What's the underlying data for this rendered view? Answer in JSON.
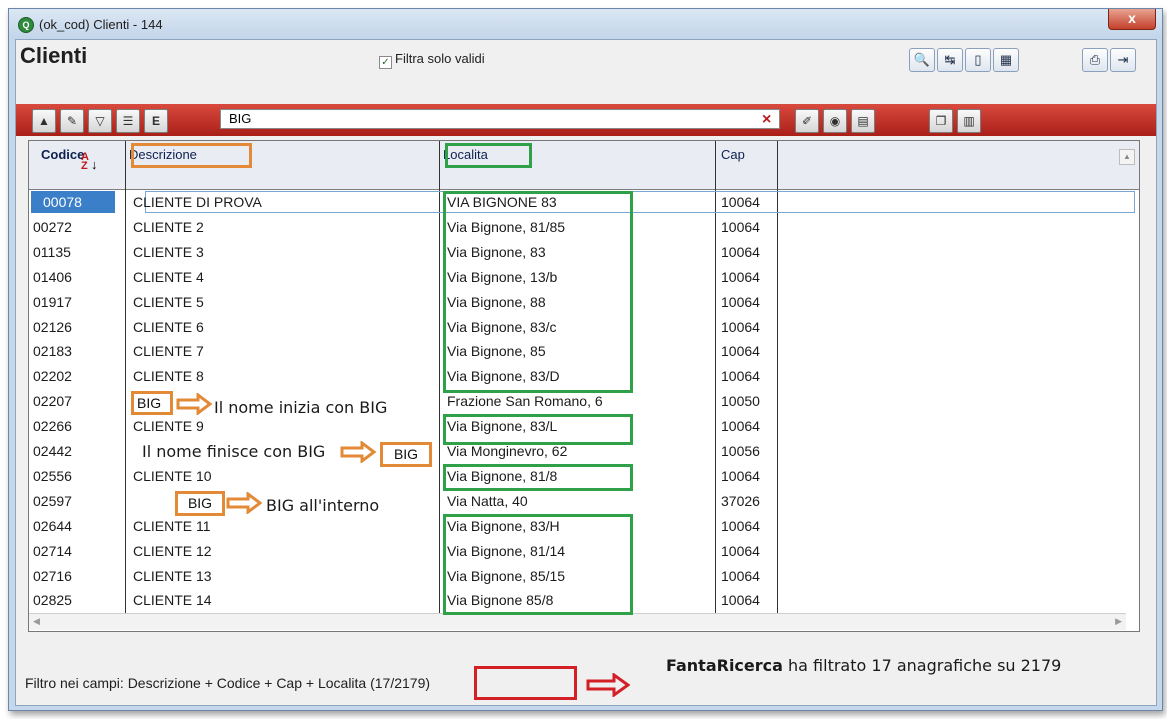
{
  "window": {
    "app_icon": "Q",
    "title": "(ok_cod) Clienti - 144",
    "close": "x"
  },
  "header": {
    "title": "Clienti",
    "filter_label": "Filtra solo validi",
    "filter_checked": true,
    "toolbar_icons": [
      "search-icon",
      "refresh-icon",
      "new-document-icon",
      "form-view-icon",
      "print-icon",
      "exit-icon"
    ]
  },
  "search": {
    "value": "BIG",
    "clear_label": "×",
    "left_icons": [
      "up-arrow-icon",
      "edit-filter-icon",
      "funnel-icon",
      "list-icon",
      "export-icon"
    ],
    "right_icons": [
      "wand-icon",
      "settings-icon",
      "note-icon",
      "window-icon",
      "doc-icon"
    ]
  },
  "columns": {
    "codice": "Codice",
    "descrizione": "Descrizione",
    "localita": "Localita",
    "cap": "Cap"
  },
  "rows": [
    {
      "codice": "00078",
      "descrizione": "CLIENTE DI PROVA",
      "localita": "VIA BIGNONE 83",
      "cap": "10064"
    },
    {
      "codice": "00272",
      "descrizione": "CLIENTE 2",
      "localita": "Via Bignone, 81/85",
      "cap": "10064"
    },
    {
      "codice": "01135",
      "descrizione": "CLIENTE 3",
      "localita": "Via Bignone, 83",
      "cap": "10064"
    },
    {
      "codice": "01406",
      "descrizione": "CLIENTE 4",
      "localita": "Via Bignone, 13/b",
      "cap": "10064"
    },
    {
      "codice": "01917",
      "descrizione": "CLIENTE 5",
      "localita": "Via Bignone, 88",
      "cap": "10064"
    },
    {
      "codice": "02126",
      "descrizione": "CLIENTE 6",
      "localita": "Via Bignone, 83/c",
      "cap": "10064"
    },
    {
      "codice": "02183",
      "descrizione": "CLIENTE 7",
      "localita": "Via Bignone, 85",
      "cap": "10064"
    },
    {
      "codice": "02202",
      "descrizione": "CLIENTE 8",
      "localita": "Via Bignone, 83/D",
      "cap": "10064"
    },
    {
      "codice": "02207",
      "descrizione": "BIG",
      "localita": "Frazione San Romano, 6",
      "cap": "10050"
    },
    {
      "codice": "02266",
      "descrizione": "CLIENTE 9",
      "localita": "Via Bignone, 83/L",
      "cap": "10064"
    },
    {
      "codice": "02442",
      "descrizione": "BIG",
      "localita": "Via Monginevro, 62",
      "cap": "10056"
    },
    {
      "codice": "02556",
      "descrizione": "CLIENTE 10",
      "localita": "Via Bignone, 81/8",
      "cap": "10064"
    },
    {
      "codice": "02597",
      "descrizione": "BIG",
      "localita": "Via Natta, 40",
      "cap": "37026"
    },
    {
      "codice": "02644",
      "descrizione": "CLIENTE 11",
      "localita": "Via Bignone, 83/H",
      "cap": "10064"
    },
    {
      "codice": "02714",
      "descrizione": "CLIENTE 12",
      "localita": "Via Bignone, 81/14",
      "cap": "10064"
    },
    {
      "codice": "02716",
      "descrizione": "CLIENTE 13",
      "localita": "Via Bignone, 85/15",
      "cap": "10064"
    },
    {
      "codice": "02825",
      "descrizione": "CLIENTE 14",
      "localita": "Via Bignone 85/8",
      "cap": "10064"
    }
  ],
  "annotations": {
    "starts_with": "Il nome inizia con BIG",
    "ends_with": "Il nome finisce con BIG",
    "contains": "BIG all'interno"
  },
  "status": {
    "filter_text": "Filtro nei campi: Descrizione + Codice + Cap + Localita ",
    "count": "(17/2179)",
    "note_bold": "FantaRicerca",
    "note_rest": " ha filtrato 17 anagrafiche su 2179"
  }
}
